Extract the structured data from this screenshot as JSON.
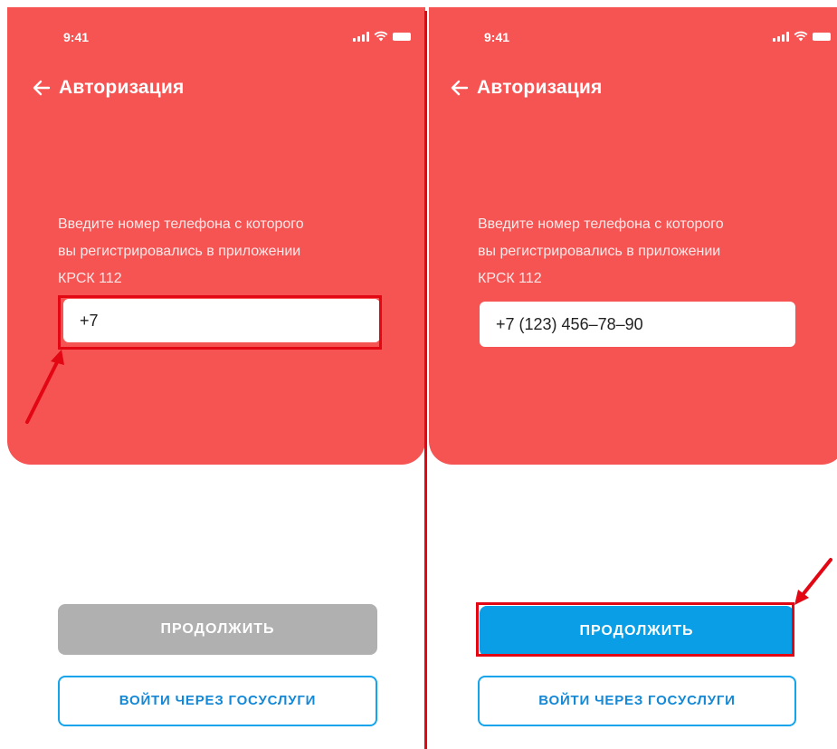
{
  "status_bar": {
    "time": "9:41"
  },
  "header": {
    "title": "Авторизация"
  },
  "prompt": {
    "line1": "Введите номер телефона с которого",
    "line2": "вы регистрировались в приложении",
    "line3": "КРСК 112"
  },
  "screens": {
    "left": {
      "phone_value": "+7"
    },
    "right": {
      "phone_value": "+7 (123) 456–78–90"
    }
  },
  "buttons": {
    "continue_label": "ПРОДОЛЖИТЬ",
    "gosuslugi_label": "ВОЙТИ ЧЕРЕЗ ГОСУСЛУГИ"
  },
  "colors": {
    "hero_red": "#f65353",
    "continue_disabled": "#b0b0b0",
    "continue_active": "#0a9ee6",
    "gosuslugi_border": "#14a4ec",
    "annotation_red": "#e30613"
  },
  "icons": {
    "back": "arrow-left-icon",
    "signal": "signal-icon",
    "wifi": "wifi-icon",
    "battery": "battery-icon"
  },
  "annotations": [
    {
      "target": "left-phone-input",
      "kind": "highlight-box-with-arrow"
    },
    {
      "target": "right-continue-button",
      "kind": "highlight-box-with-arrow"
    }
  ]
}
